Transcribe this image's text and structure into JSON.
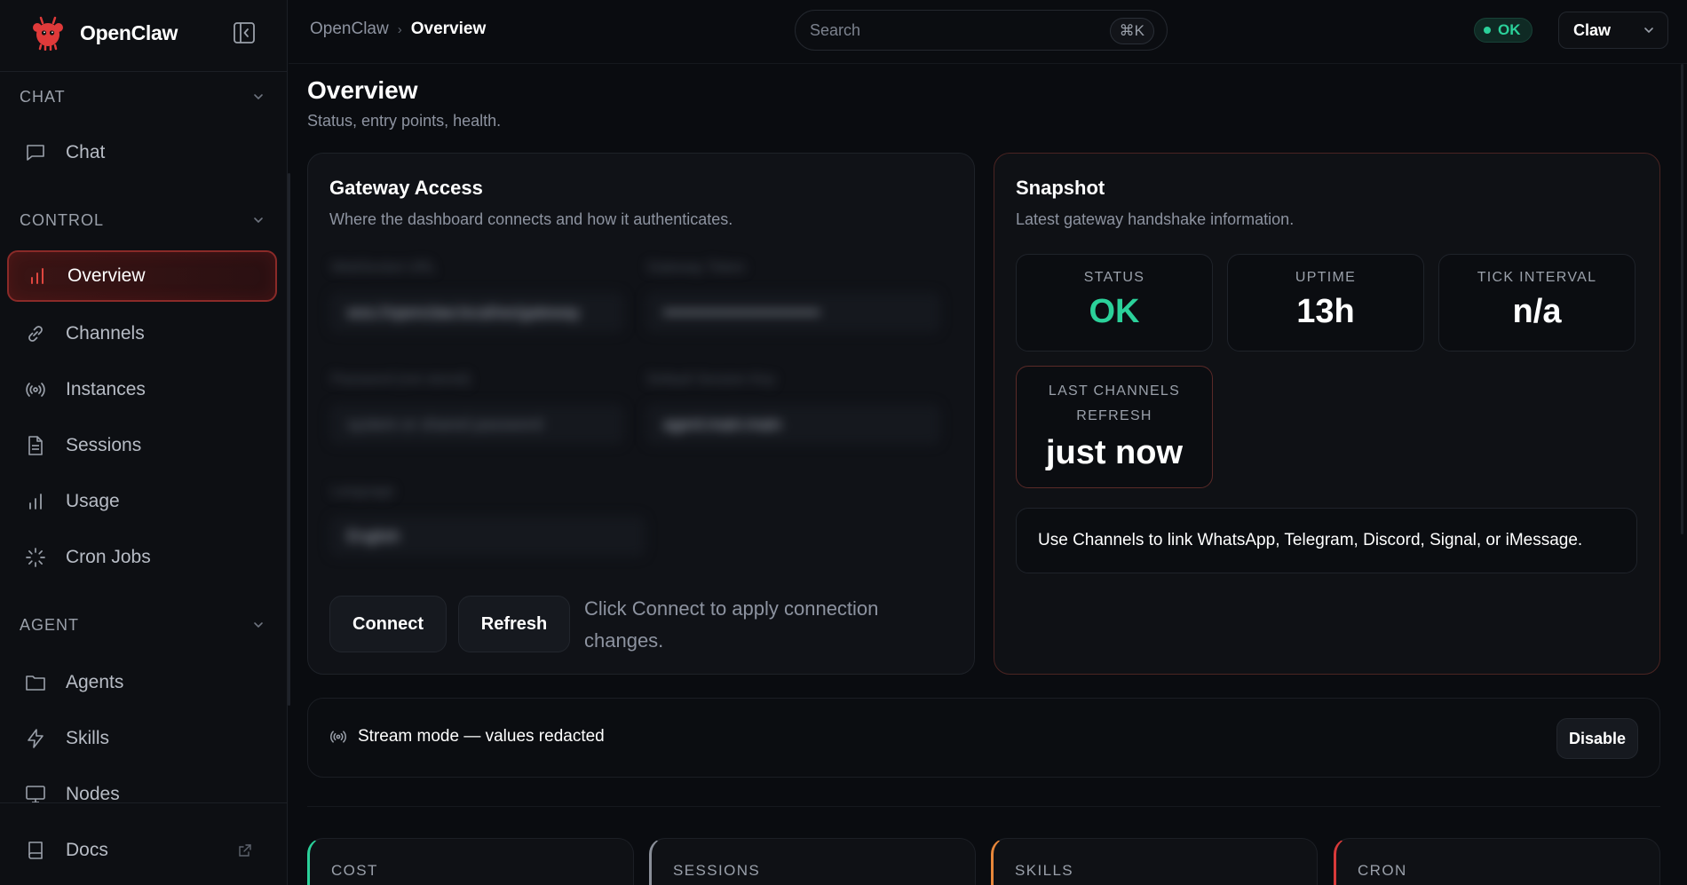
{
  "app": {
    "name": "OpenClaw"
  },
  "sidebar": {
    "sections": [
      {
        "label": "CHAT",
        "items": [
          {
            "label": "Chat",
            "icon": "chat-bubble-icon"
          }
        ]
      },
      {
        "label": "CONTROL",
        "items": [
          {
            "label": "Overview",
            "icon": "bar-chart-icon",
            "active": true
          },
          {
            "label": "Channels",
            "icon": "link-icon"
          },
          {
            "label": "Instances",
            "icon": "broadcast-icon"
          },
          {
            "label": "Sessions",
            "icon": "document-icon"
          },
          {
            "label": "Usage",
            "icon": "bar-chart-icon"
          },
          {
            "label": "Cron Jobs",
            "icon": "spinner-icon"
          }
        ]
      },
      {
        "label": "AGENT",
        "items": [
          {
            "label": "Agents",
            "icon": "folder-icon"
          },
          {
            "label": "Skills",
            "icon": "lightning-icon"
          },
          {
            "label": "Nodes",
            "icon": "monitor-icon"
          }
        ]
      }
    ],
    "docs": {
      "label": "Docs",
      "icon": "book-icon"
    }
  },
  "topbar": {
    "breadcrumb": [
      "OpenClaw",
      "Overview"
    ],
    "search": {
      "placeholder": "Search",
      "shortcut": "⌘K"
    },
    "status": "OK",
    "user": "Claw"
  },
  "page": {
    "title": "Overview",
    "subtitle": "Status, entry points, health."
  },
  "gateway": {
    "title": "Gateway Access",
    "subtitle": "Where the dashboard connects and how it authenticates.",
    "fields": [
      {
        "label": "WebSocket URL",
        "value": "wss://openclaw.local/ws/gateway"
      },
      {
        "label": "Gateway Token",
        "value": "••••••••••••••••••••••••••••"
      },
      {
        "label": "Password (not stored)",
        "value": "system or shared password"
      },
      {
        "label": "Default Session Key",
        "value": "agent:main:main"
      },
      {
        "label": "Language",
        "value": "English"
      }
    ],
    "connect_label": "Connect",
    "refresh_label": "Refresh",
    "hint": "Click Connect to apply connection changes."
  },
  "snapshot": {
    "title": "Snapshot",
    "subtitle": "Latest gateway handshake information.",
    "stats": [
      {
        "label": "STATUS",
        "value": "OK"
      },
      {
        "label": "UPTIME",
        "value": "13h"
      },
      {
        "label": "TICK INTERVAL",
        "value": "n/a"
      },
      {
        "label": "LAST CHANNELS REFRESH",
        "value": "just now"
      }
    ],
    "notice": "Use Channels to link WhatsApp, Telegram, Discord, Signal, or iMessage."
  },
  "stream": {
    "text": "Stream mode — values redacted",
    "disable_label": "Disable"
  },
  "summary_cards": [
    {
      "label": "COST",
      "accent": "#2bd19a"
    },
    {
      "label": "SESSIONS",
      "accent": "#8a8f99"
    },
    {
      "label": "SKILLS",
      "accent": "#e8873a"
    },
    {
      "label": "CRON",
      "accent": "#d83a3a"
    }
  ],
  "colors": {
    "accent_ok": "#2bd19a",
    "accent_brand": "#e23b3b",
    "background": "#0a0c10"
  }
}
